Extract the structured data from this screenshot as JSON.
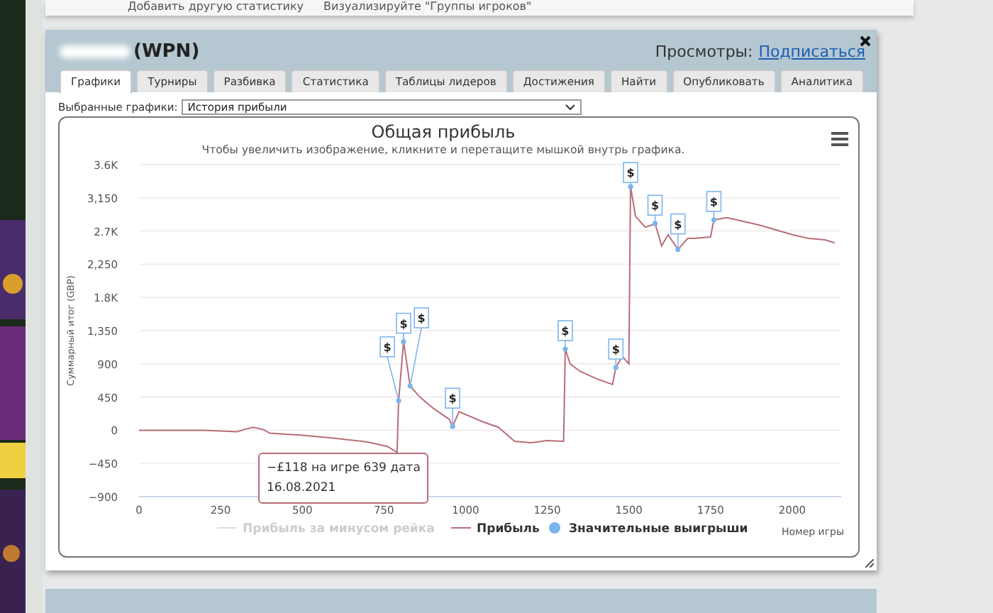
{
  "top_toolbar": {
    "items": [
      "Добавить другую статистику",
      "Визуализируйте \"Группы игроков\""
    ]
  },
  "panel": {
    "title": "(WPN)",
    "views_label": "Просмотры:",
    "subscribe_link": "Подписаться",
    "tabs": [
      {
        "label": "Графики",
        "selected": true
      },
      {
        "label": "Турниры",
        "selected": false
      },
      {
        "label": "Разбивка",
        "selected": false
      },
      {
        "label": "Статистика",
        "selected": false
      },
      {
        "label": "Таблицы лидеров",
        "selected": false
      },
      {
        "label": "Достижения",
        "selected": false
      },
      {
        "label": "Найти",
        "selected": false
      },
      {
        "label": "Опубликовать",
        "selected": false
      },
      {
        "label": "Аналитика",
        "selected": false
      }
    ],
    "graph_select": {
      "label": "Выбранные графики:",
      "value": "История прибыли"
    },
    "chart": {
      "chart_data": {
        "type": "line",
        "title": "Общая прибыль",
        "subtitle": "Чтобы увеличить изображение, кликните и перетащите мышкой внутрь графика.",
        "xlabel": "Номер игры",
        "ylabel": "Суммарный итог (GBP)",
        "grid": true,
        "legend": "bottom",
        "x": [
          0,
          100,
          200,
          250,
          300,
          330,
          350,
          380,
          400,
          500,
          600,
          700,
          760,
          790,
          795,
          810,
          830,
          860,
          900,
          950,
          960,
          980,
          1050,
          1100,
          1150,
          1200,
          1250,
          1300,
          1305,
          1320,
          1350,
          1400,
          1450,
          1460,
          1480,
          1500,
          1505,
          1520,
          1550,
          1580,
          1600,
          1620,
          1650,
          1680,
          1700,
          1750,
          1760,
          1800,
          1900,
          2000,
          2050,
          2100,
          2130
        ],
        "series": [
          {
            "name": "Прибыль",
            "color": "#b86e78",
            "type": "line",
            "values": [
              0,
              0,
              0,
              -10,
              -20,
              20,
              40,
              10,
              -40,
              -70,
              -110,
              -160,
              -220,
              -300,
              400,
              1200,
              600,
              450,
              300,
              150,
              50,
              250,
              120,
              40,
              -150,
              -170,
              -140,
              -150,
              1100,
              900,
              800,
              700,
              620,
              850,
              1000,
              900,
              3300,
              2900,
              2750,
              2800,
              2500,
              2650,
              2450,
              2600,
              2600,
              2620,
              2850,
              2880,
              2780,
              2650,
              2600,
              2580,
              2540
            ]
          },
          {
            "name": "Значительные выигрыши",
            "color": "#7cb5ec",
            "type": "scatter",
            "values": [
              null,
              null,
              null,
              null,
              null,
              null,
              null,
              null,
              null,
              null,
              null,
              null,
              null,
              null,
              400,
              1200,
              600,
              null,
              null,
              null,
              50,
              null,
              null,
              null,
              null,
              null,
              null,
              null,
              1100,
              null,
              null,
              null,
              null,
              850,
              null,
              null,
              3300,
              null,
              null,
              2800,
              null,
              null,
              2450,
              null,
              null,
              null,
              2850,
              null,
              null,
              null,
              null,
              null,
              null
            ]
          }
        ],
        "xlim": [
          0,
          2150
        ],
        "ylim": [
          -900,
          3600
        ],
        "xticks": [
          0,
          250,
          500,
          750,
          1000,
          1250,
          1500,
          1750,
          2000
        ],
        "yticks": [
          {
            "value": -900,
            "label": "−900"
          },
          {
            "value": -450,
            "label": "−450"
          },
          {
            "value": 0,
            "label": "0"
          },
          {
            "value": 450,
            "label": "450"
          },
          {
            "value": 900,
            "label": "900"
          },
          {
            "value": 1350,
            "label": "1,350"
          },
          {
            "value": 1800,
            "label": "1.8K"
          },
          {
            "value": 2250,
            "label": "2,250"
          },
          {
            "value": 2700,
            "label": "2.7K"
          },
          {
            "value": 3150,
            "label": "3,150"
          },
          {
            "value": 3600,
            "label": "3.6K"
          }
        ]
      },
      "flag_text": "$",
      "hidden_legend": [
        {
          "label": "Прибыль за минусом рейка"
        }
      ],
      "tooltip": {
        "lines": [
          "−£118 на игре 639 дата",
          "16.08.2021"
        ]
      }
    }
  }
}
